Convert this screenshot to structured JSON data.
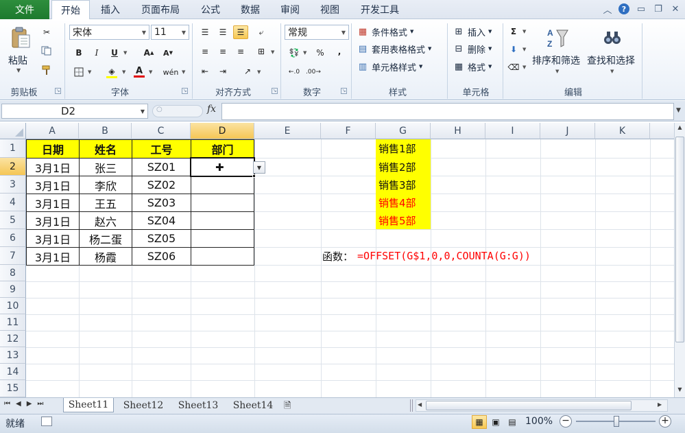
{
  "menu": {
    "file": "文件",
    "tabs": [
      "开始",
      "插入",
      "页面布局",
      "公式",
      "数据",
      "审阅",
      "视图",
      "开发工具"
    ]
  },
  "ribbon": {
    "clipboard": {
      "paste": "粘贴",
      "label": "剪贴板"
    },
    "font": {
      "name": "宋体",
      "size": "11",
      "label": "字体"
    },
    "align": {
      "label": "对齐方式"
    },
    "number": {
      "format": "常规",
      "percent": "%",
      "comma": ",",
      "label": "数字"
    },
    "styles": {
      "cond": "条件格式",
      "table": "套用表格格式",
      "cell": "单元格样式",
      "label": "样式"
    },
    "cells": {
      "insert": "插入",
      "delete": "删除",
      "format": "格式",
      "label": "单元格"
    },
    "editing": {
      "sort": "排序和筛选",
      "find": "查找和选择",
      "label": "编辑"
    }
  },
  "formula_bar": {
    "name_box": "D2",
    "fx": "fx",
    "value": ""
  },
  "columns": [
    "A",
    "B",
    "C",
    "D",
    "E",
    "F",
    "G",
    "H",
    "I",
    "J",
    "K"
  ],
  "rows": [
    "1",
    "2",
    "3",
    "4",
    "5",
    "6",
    "7",
    "8",
    "9",
    "10",
    "11",
    "12",
    "13",
    "14",
    "15"
  ],
  "table": {
    "headers": [
      "日期",
      "姓名",
      "工号",
      "部门"
    ],
    "rows": [
      [
        "3月1日",
        "张三",
        "SZ01",
        ""
      ],
      [
        "3月1日",
        "李欣",
        "SZ02",
        ""
      ],
      [
        "3月1日",
        "王五",
        "SZ03",
        ""
      ],
      [
        "3月1日",
        "赵六",
        "SZ04",
        ""
      ],
      [
        "3月1日",
        "杨二蛋",
        "SZ05",
        ""
      ],
      [
        "3月1日",
        "杨霞",
        "SZ06",
        ""
      ]
    ]
  },
  "dept_list": [
    "销售1部",
    "销售2部",
    "销售3部",
    "销售4部",
    "销售5部"
  ],
  "dept_colors": [
    "#000000",
    "#000000",
    "#000000",
    "#ff0000",
    "#ff0000"
  ],
  "formula_note": {
    "label": "函数：",
    "formula": "=OFFSET(G$1,0,0,COUNTA(G:G))"
  },
  "sheets": [
    "Sheet11",
    "Sheet12",
    "Sheet13",
    "Sheet14"
  ],
  "status": {
    "ready": "就绪",
    "zoom": "100%"
  },
  "colors": {
    "header_fill": "#ffff00",
    "formula_red": "#ff0000",
    "file_tab": "#1d7a2e"
  }
}
